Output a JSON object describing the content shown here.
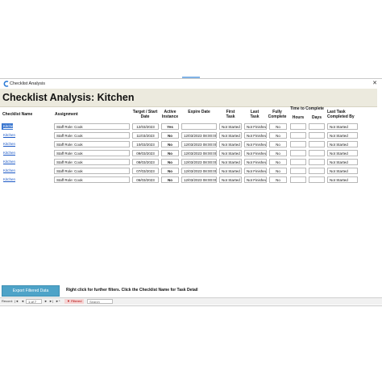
{
  "window": {
    "title": "Checklist Analysis",
    "close_glyph": "✕",
    "icon": "access-app-icon"
  },
  "header": {
    "title": "Checklist Analysis: Kitchen"
  },
  "columns": {
    "checklist_name": "Checklist Name",
    "assignment": "Assignment",
    "target_start": "Target / Start Date",
    "active_instance": "Active Instance",
    "expire_date": "Expire Date",
    "first_task": "First Task",
    "last_task": "Last Task",
    "fully_complete": "Fully Complete",
    "time_to_complete": "Time to Complete",
    "hours": "Hours",
    "days": "Days",
    "last_task_completed_by": "Last Task Completed By"
  },
  "rows": [
    {
      "name": "Kitchen",
      "assignment": "Staff Role: Cook",
      "start": "12/03/2023",
      "active": "Yes",
      "expire": "",
      "first": "Not Started",
      "last": "Not Finished",
      "complete": "No",
      "hours": "",
      "days": "",
      "completed_by": "Not Started"
    },
    {
      "name": "Kitchen",
      "assignment": "Staff Role: Cook",
      "start": "11/03/2023",
      "active": "No",
      "expire": "12/03/2023 08:00:00",
      "first": "Not Started",
      "last": "Not Finished",
      "complete": "No",
      "hours": "",
      "days": "",
      "completed_by": "Not Started"
    },
    {
      "name": "Kitchen",
      "assignment": "Staff Role: Cook",
      "start": "10/03/2023",
      "active": "No",
      "expire": "12/03/2023 08:00:00",
      "first": "Not Started",
      "last": "Not Finished",
      "complete": "No",
      "hours": "",
      "days": "",
      "completed_by": "Not Started"
    },
    {
      "name": "Kitchen",
      "assignment": "Staff Role: Cook",
      "start": "09/03/2023",
      "active": "No",
      "expire": "12/03/2023 08:00:00",
      "first": "Not Started",
      "last": "Not Finished",
      "complete": "No",
      "hours": "",
      "days": "",
      "completed_by": "Not Started"
    },
    {
      "name": "Kitchen",
      "assignment": "Staff Role: Cook",
      "start": "08/03/2023",
      "active": "No",
      "expire": "12/03/2023 08:00:00",
      "first": "Not Started",
      "last": "Not Finished",
      "complete": "No",
      "hours": "",
      "days": "",
      "completed_by": "Not Started"
    },
    {
      "name": "Kitchen",
      "assignment": "Staff Role: Cook",
      "start": "07/03/2023",
      "active": "No",
      "expire": "12/03/2023 08:00:00",
      "first": "Not Started",
      "last": "Not Finished",
      "complete": "No",
      "hours": "",
      "days": "",
      "completed_by": "Not Started"
    },
    {
      "name": "Kitchen",
      "assignment": "Staff Role: Cook",
      "start": "06/03/2023",
      "active": "No",
      "expire": "12/03/2023 08:00:00",
      "first": "Not Started",
      "last": "Not Finished",
      "complete": "No",
      "hours": "",
      "days": "",
      "completed_by": "Not Started"
    }
  ],
  "footer": {
    "export_label": "Export Filtered Data",
    "hint": "Right click for further filters.  Click the Checklist Name for Task Detail"
  },
  "navbar": {
    "record_label": "Record:",
    "first": "|◄",
    "prev": "◄",
    "position": "1 of 7",
    "next": "►",
    "last": "►|",
    "new": "►*",
    "filtered_label": "Filtered",
    "search_placeholder": "Search"
  },
  "colors": {
    "header_bg": "#eceade",
    "link": "#1b58c5",
    "export_btn": "#4ea3c8",
    "selection": "#3c78d0"
  }
}
